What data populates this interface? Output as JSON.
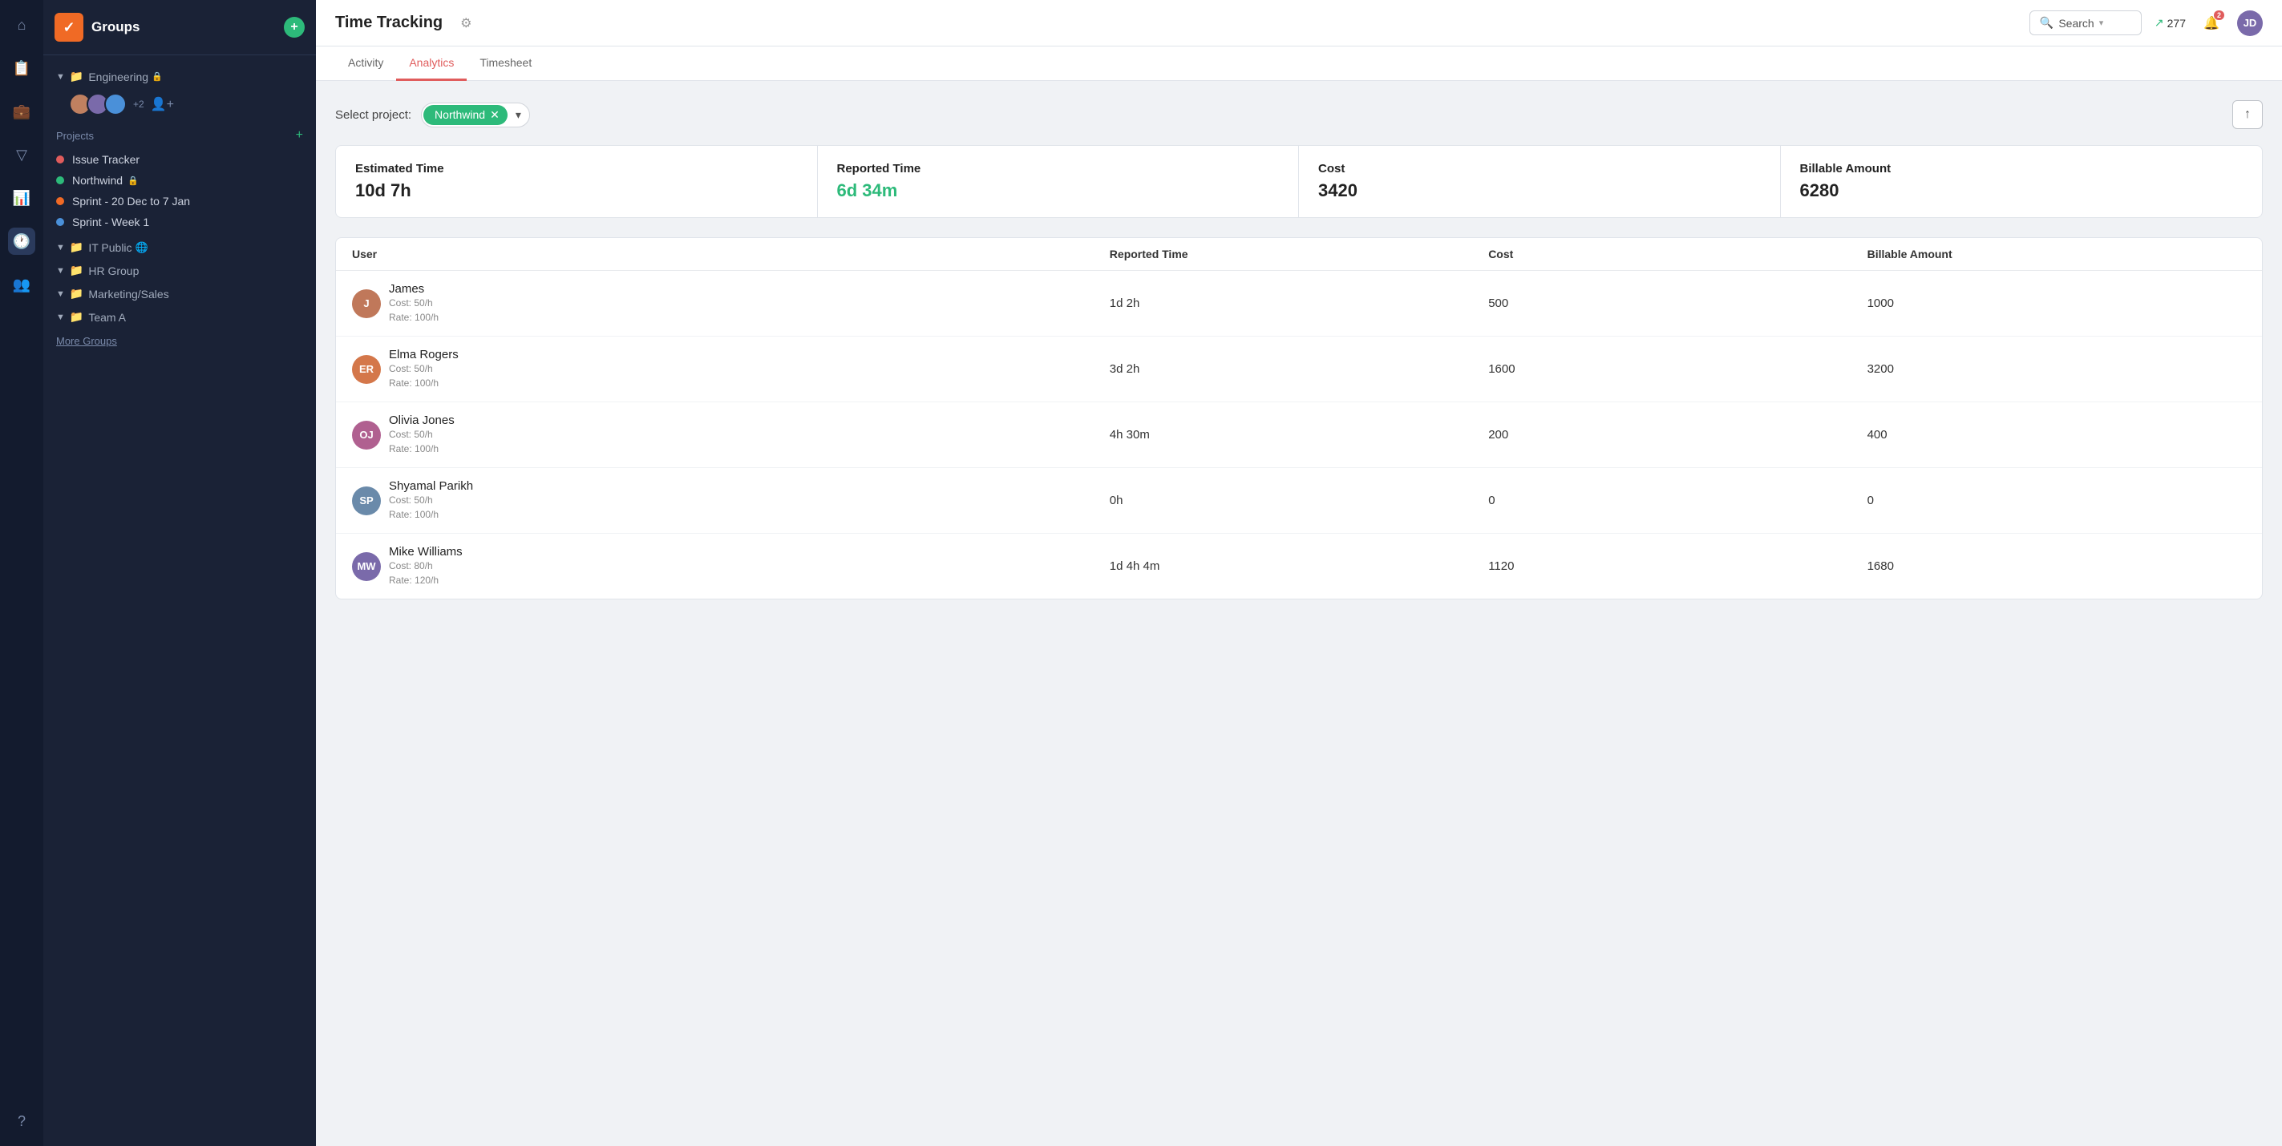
{
  "app": {
    "icon": "✓",
    "groups_title": "Groups",
    "add_button": "+"
  },
  "sidebar": {
    "engineering_group": {
      "label": "Engineering",
      "has_lock": true,
      "member_count": "+2"
    },
    "projects_label": "Projects",
    "projects_add": "+",
    "projects": [
      {
        "id": "issue-tracker",
        "label": "Issue Tracker",
        "dot_color": "#e05c5c"
      },
      {
        "id": "northwind",
        "label": "Northwind",
        "dot_color": "#2dba7a",
        "has_lock": true
      },
      {
        "id": "sprint-dec",
        "label": "Sprint - 20 Dec to 7 Jan",
        "dot_color": "#f06a25"
      },
      {
        "id": "sprint-week1",
        "label": "Sprint - Week 1",
        "dot_color": "#4a90d9"
      }
    ],
    "sub_groups": [
      {
        "id": "it-public",
        "label": "IT Public",
        "has_globe": true
      },
      {
        "id": "hr-group",
        "label": "HR Group"
      },
      {
        "id": "marketing-sales",
        "label": "Marketing/Sales"
      },
      {
        "id": "team-a",
        "label": "Team A"
      }
    ],
    "more_groups": "More Groups"
  },
  "header": {
    "title": "Time Tracking",
    "gear_icon": "⚙",
    "search_placeholder": "Search",
    "trend_count": "277",
    "notif_count": "2",
    "user_initials": "JD"
  },
  "tabs": [
    {
      "id": "activity",
      "label": "Activity"
    },
    {
      "id": "analytics",
      "label": "Analytics",
      "active": true
    },
    {
      "id": "timesheet",
      "label": "Timesheet"
    }
  ],
  "filter": {
    "label": "Select project:",
    "project_tag": "Northwind",
    "dropdown_arrow": "▾",
    "export_icon": "↑"
  },
  "summary": [
    {
      "id": "estimated-time",
      "label": "Estimated Time",
      "value": "10d 7h",
      "green": false
    },
    {
      "id": "reported-time",
      "label": "Reported Time",
      "value": "6d 34m",
      "green": true
    },
    {
      "id": "cost",
      "label": "Cost",
      "value": "3420",
      "green": false
    },
    {
      "id": "billable-amount",
      "label": "Billable Amount",
      "value": "6280",
      "green": false
    }
  ],
  "table": {
    "headers": [
      {
        "id": "user",
        "label": "User"
      },
      {
        "id": "reported-time",
        "label": "Reported Time"
      },
      {
        "id": "cost",
        "label": "Cost"
      },
      {
        "id": "billable-amount",
        "label": "Billable Amount"
      }
    ],
    "rows": [
      {
        "id": "james",
        "name": "James",
        "cost_rate": "Cost: 50/h",
        "bill_rate": "Rate: 100/h",
        "reported_time": "1d 2h",
        "cost": "500",
        "billable": "1000",
        "avatar_bg": "#c0785a",
        "initials": "J"
      },
      {
        "id": "elma-rogers",
        "name": "Elma Rogers",
        "cost_rate": "Cost: 50/h",
        "bill_rate": "Rate: 100/h",
        "reported_time": "3d 2h",
        "cost": "1600",
        "billable": "3200",
        "avatar_bg": "#d4774a",
        "initials": "ER"
      },
      {
        "id": "olivia-jones",
        "name": "Olivia Jones",
        "cost_rate": "Cost: 50/h",
        "bill_rate": "Rate: 100/h",
        "reported_time": "4h 30m",
        "cost": "200",
        "billable": "400",
        "avatar_bg": "#b06090",
        "initials": "OJ"
      },
      {
        "id": "shyamal-parikh",
        "name": "Shyamal Parikh",
        "cost_rate": "Cost: 50/h",
        "bill_rate": "Rate: 100/h",
        "reported_time": "0h",
        "cost": "0",
        "billable": "0",
        "avatar_bg": "#6a8aaa",
        "initials": "SP"
      },
      {
        "id": "mike-williams",
        "name": "Mike Williams",
        "cost_rate": "Cost: 80/h",
        "bill_rate": "Rate: 120/h",
        "reported_time": "1d 4h 4m",
        "cost": "1120",
        "billable": "1680",
        "avatar_bg": "#7a6aaa",
        "initials": "MW"
      }
    ]
  }
}
